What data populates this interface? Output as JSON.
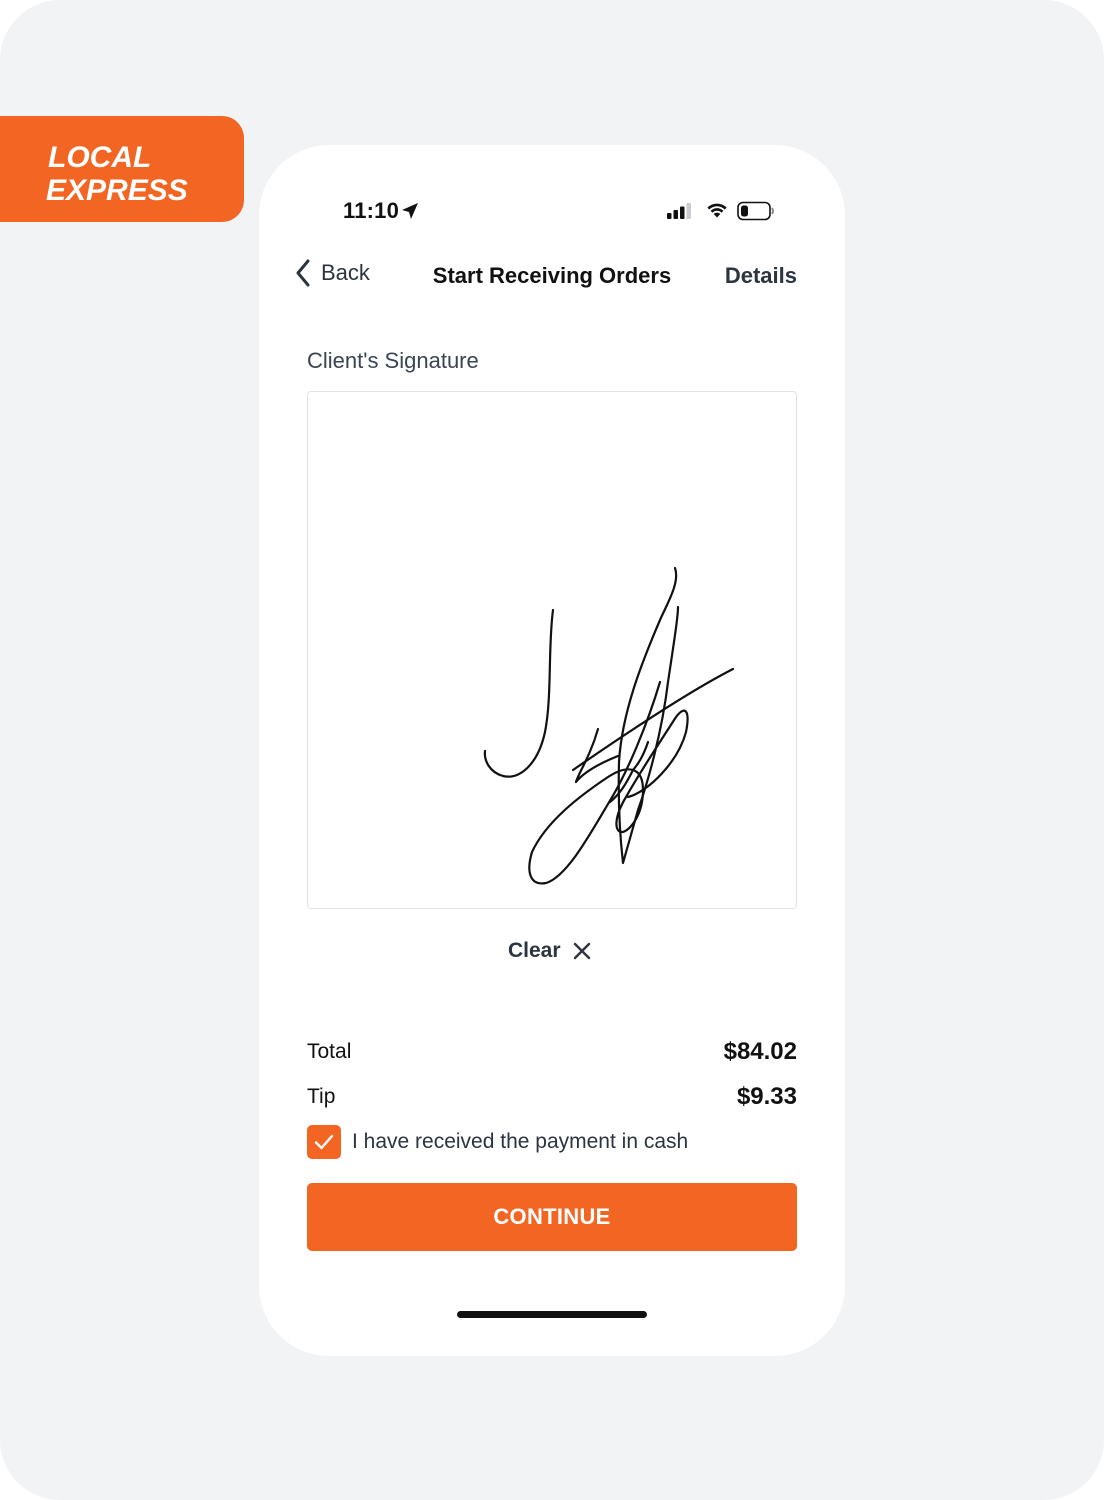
{
  "brand": {
    "logo_line1": "LOCAL",
    "logo_line2": "EXPRESS",
    "color": "#f26522"
  },
  "status_bar": {
    "time": "11:10",
    "icons": [
      "location-arrow-icon",
      "cellular-signal-icon",
      "wifi-icon",
      "battery-icon"
    ]
  },
  "nav": {
    "back_label": "Back",
    "title": "Start Receiving Orders",
    "details_label": "Details"
  },
  "signature": {
    "label": "Client's Signature",
    "clear_label": "Clear"
  },
  "summary": {
    "total_label": "Total",
    "total_value": "$84.02",
    "tip_label": "Tip",
    "tip_value": "$9.33"
  },
  "cash": {
    "label": "I have received the payment in cash",
    "checked": true
  },
  "actions": {
    "continue_label": "CONTINUE"
  },
  "colors": {
    "accent": "#f26522",
    "text_dark": "#111111",
    "text_muted": "#2c3440",
    "background": "#f2f3f5"
  }
}
